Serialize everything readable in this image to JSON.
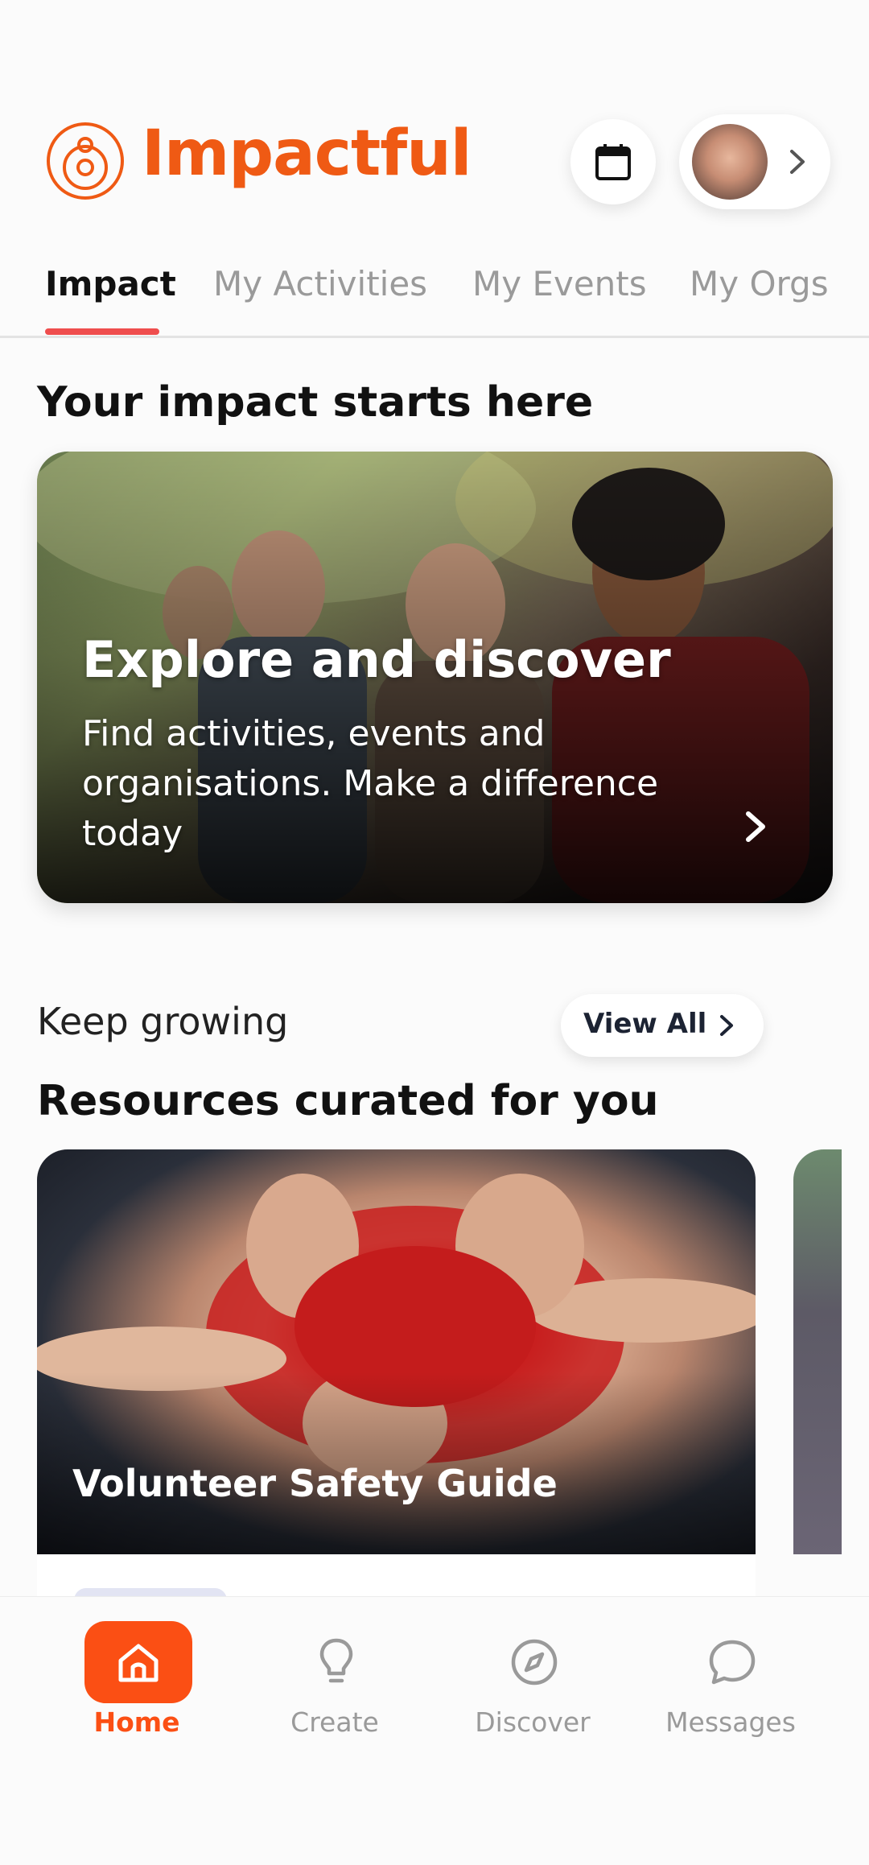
{
  "app": {
    "name": "Impactful",
    "brand_color": "#ef5a14"
  },
  "header": {
    "calendar_icon": "calendar-icon",
    "profile_chevron_icon": "chevron-right-icon"
  },
  "tabs": [
    {
      "label": "Impact",
      "active": true
    },
    {
      "label": "My Activities",
      "active": false
    },
    {
      "label": "My Events",
      "active": false
    },
    {
      "label": "My Orgs",
      "active": false
    }
  ],
  "impact": {
    "heading": "Your impact starts here",
    "hero": {
      "title": "Explore and discover",
      "description": "Find activities, events and organisations. Make a difference today"
    }
  },
  "resources": {
    "subheading": "Keep growing",
    "view_all_label": "View All",
    "heading": "Resources curated for you",
    "cards": [
      {
        "title": "Volunteer Safety Guide"
      }
    ]
  },
  "bottom_nav": {
    "items": [
      {
        "label": "Home",
        "icon": "home-icon",
        "active": true
      },
      {
        "label": "Create",
        "icon": "lightbulb-icon",
        "active": false
      },
      {
        "label": "Discover",
        "icon": "compass-icon",
        "active": false
      },
      {
        "label": "Messages",
        "icon": "chat-bubble-icon",
        "active": false
      }
    ],
    "active_color": "#fb4f14"
  }
}
